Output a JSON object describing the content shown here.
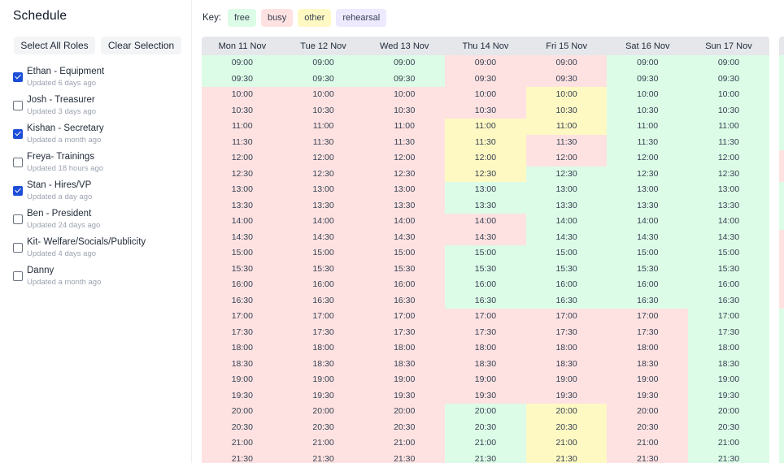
{
  "sidebar": {
    "title": "Schedule",
    "select_all_label": "Select All Roles",
    "clear_label": "Clear Selection",
    "roles": [
      {
        "name": "Ethan - Equipment",
        "updated": "Updated 6 days ago",
        "checked": true
      },
      {
        "name": "Josh - Treasurer",
        "updated": "Updated 3 days ago",
        "checked": false
      },
      {
        "name": "Kishan - Secretary",
        "updated": "Updated a month ago",
        "checked": true
      },
      {
        "name": "Freya- Trainings",
        "updated": "Updated 18 hours ago",
        "checked": false
      },
      {
        "name": "Stan - Hires/VP",
        "updated": "Updated a day ago",
        "checked": true
      },
      {
        "name": "Ben - President",
        "updated": "Updated 24 days ago",
        "checked": false
      },
      {
        "name": "Kit- Welfare/Socials/Publicity",
        "updated": "Updated 4 days ago",
        "checked": false
      },
      {
        "name": "Danny",
        "updated": "Updated a month ago",
        "checked": false
      }
    ]
  },
  "key": {
    "label": "Key:",
    "items": [
      {
        "status": "free",
        "label": "free",
        "color": "#dcfce7"
      },
      {
        "status": "busy",
        "label": "busy",
        "color": "#fee2e2"
      },
      {
        "status": "other",
        "label": "other",
        "color": "#fef9c3"
      },
      {
        "status": "rehearsal",
        "label": "rehearsal",
        "color": "#ede9fe"
      }
    ]
  },
  "schedule": {
    "times": [
      "09:00",
      "09:30",
      "10:00",
      "10:30",
      "11:00",
      "11:30",
      "12:00",
      "12:30",
      "13:00",
      "13:30",
      "14:00",
      "14:30",
      "15:00",
      "15:30",
      "16:00",
      "16:30",
      "17:00",
      "17:30",
      "18:00",
      "18:30",
      "19:00",
      "19:30",
      "20:00",
      "20:30",
      "21:00",
      "21:30"
    ],
    "days": [
      {
        "label": "Mon 11 Nov",
        "status": [
          "free",
          "free",
          "busy",
          "busy",
          "busy",
          "busy",
          "busy",
          "busy",
          "busy",
          "busy",
          "busy",
          "busy",
          "busy",
          "busy",
          "busy",
          "busy",
          "busy",
          "busy",
          "busy",
          "busy",
          "busy",
          "busy",
          "busy",
          "busy",
          "busy",
          "busy"
        ]
      },
      {
        "label": "Tue 12 Nov",
        "status": [
          "free",
          "free",
          "busy",
          "busy",
          "busy",
          "busy",
          "busy",
          "busy",
          "busy",
          "busy",
          "busy",
          "busy",
          "busy",
          "busy",
          "busy",
          "busy",
          "busy",
          "busy",
          "busy",
          "busy",
          "busy",
          "busy",
          "busy",
          "busy",
          "busy",
          "busy"
        ]
      },
      {
        "label": "Wed 13 Nov",
        "status": [
          "free",
          "free",
          "busy",
          "busy",
          "busy",
          "busy",
          "busy",
          "busy",
          "busy",
          "busy",
          "busy",
          "busy",
          "busy",
          "busy",
          "busy",
          "busy",
          "busy",
          "busy",
          "busy",
          "busy",
          "busy",
          "busy",
          "busy",
          "busy",
          "busy",
          "busy"
        ]
      },
      {
        "label": "Thu 14 Nov",
        "status": [
          "busy",
          "busy",
          "busy",
          "busy",
          "other",
          "other",
          "other",
          "other",
          "free",
          "free",
          "busy",
          "busy",
          "free",
          "free",
          "free",
          "free",
          "busy",
          "busy",
          "busy",
          "busy",
          "busy",
          "busy",
          "free",
          "free",
          "free",
          "free"
        ]
      },
      {
        "label": "Fri 15 Nov",
        "status": [
          "busy",
          "busy",
          "other",
          "other",
          "other",
          "busy",
          "busy",
          "free",
          "free",
          "free",
          "free",
          "free",
          "free",
          "free",
          "free",
          "free",
          "busy",
          "busy",
          "busy",
          "busy",
          "busy",
          "busy",
          "other",
          "other",
          "other",
          "other"
        ]
      },
      {
        "label": "Sat 16 Nov",
        "status": [
          "free",
          "free",
          "free",
          "free",
          "free",
          "free",
          "free",
          "free",
          "free",
          "free",
          "free",
          "free",
          "free",
          "free",
          "free",
          "free",
          "busy",
          "busy",
          "busy",
          "busy",
          "busy",
          "busy",
          "busy",
          "busy",
          "busy",
          "busy"
        ]
      },
      {
        "label": "Sun 17 Nov",
        "status": [
          "free",
          "free",
          "free",
          "free",
          "free",
          "free",
          "free",
          "free",
          "free",
          "free",
          "free",
          "free",
          "free",
          "free",
          "free",
          "free",
          "free",
          "free",
          "free",
          "free",
          "free",
          "free",
          "free",
          "free",
          "free",
          "free"
        ]
      }
    ],
    "next_week_partial_status": [
      "free",
      "free",
      "free",
      "free",
      "free",
      "free",
      "busy",
      "busy",
      "free",
      "free",
      "free",
      "busy",
      "busy",
      "busy",
      "busy",
      "busy",
      "free",
      "free",
      "free",
      "free",
      "free",
      "free",
      "free",
      "free",
      "free",
      "free"
    ]
  }
}
